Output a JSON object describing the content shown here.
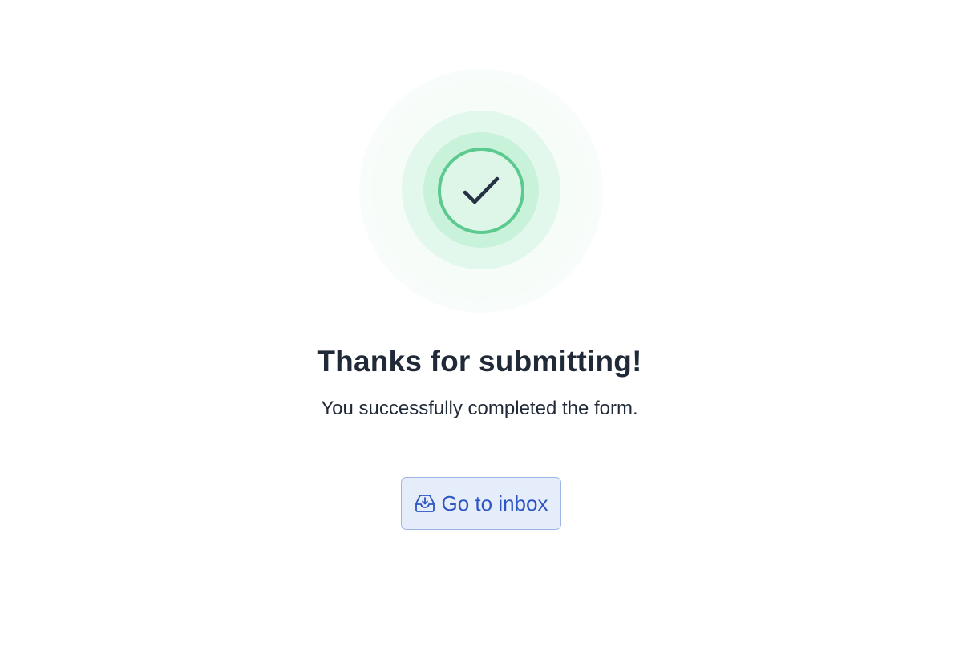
{
  "confirmation": {
    "title": "Thanks for submitting!",
    "message": "You successfully completed the form.",
    "button_label": "Go to inbox",
    "button_icon": "inbox-download-icon",
    "status_icon": "check-icon"
  },
  "colors": {
    "success_green": "#5cc98f",
    "heading_text": "#1f2937",
    "button_text": "#2e55c4",
    "button_bg": "#e6edfa",
    "button_border": "#9db4ea"
  }
}
